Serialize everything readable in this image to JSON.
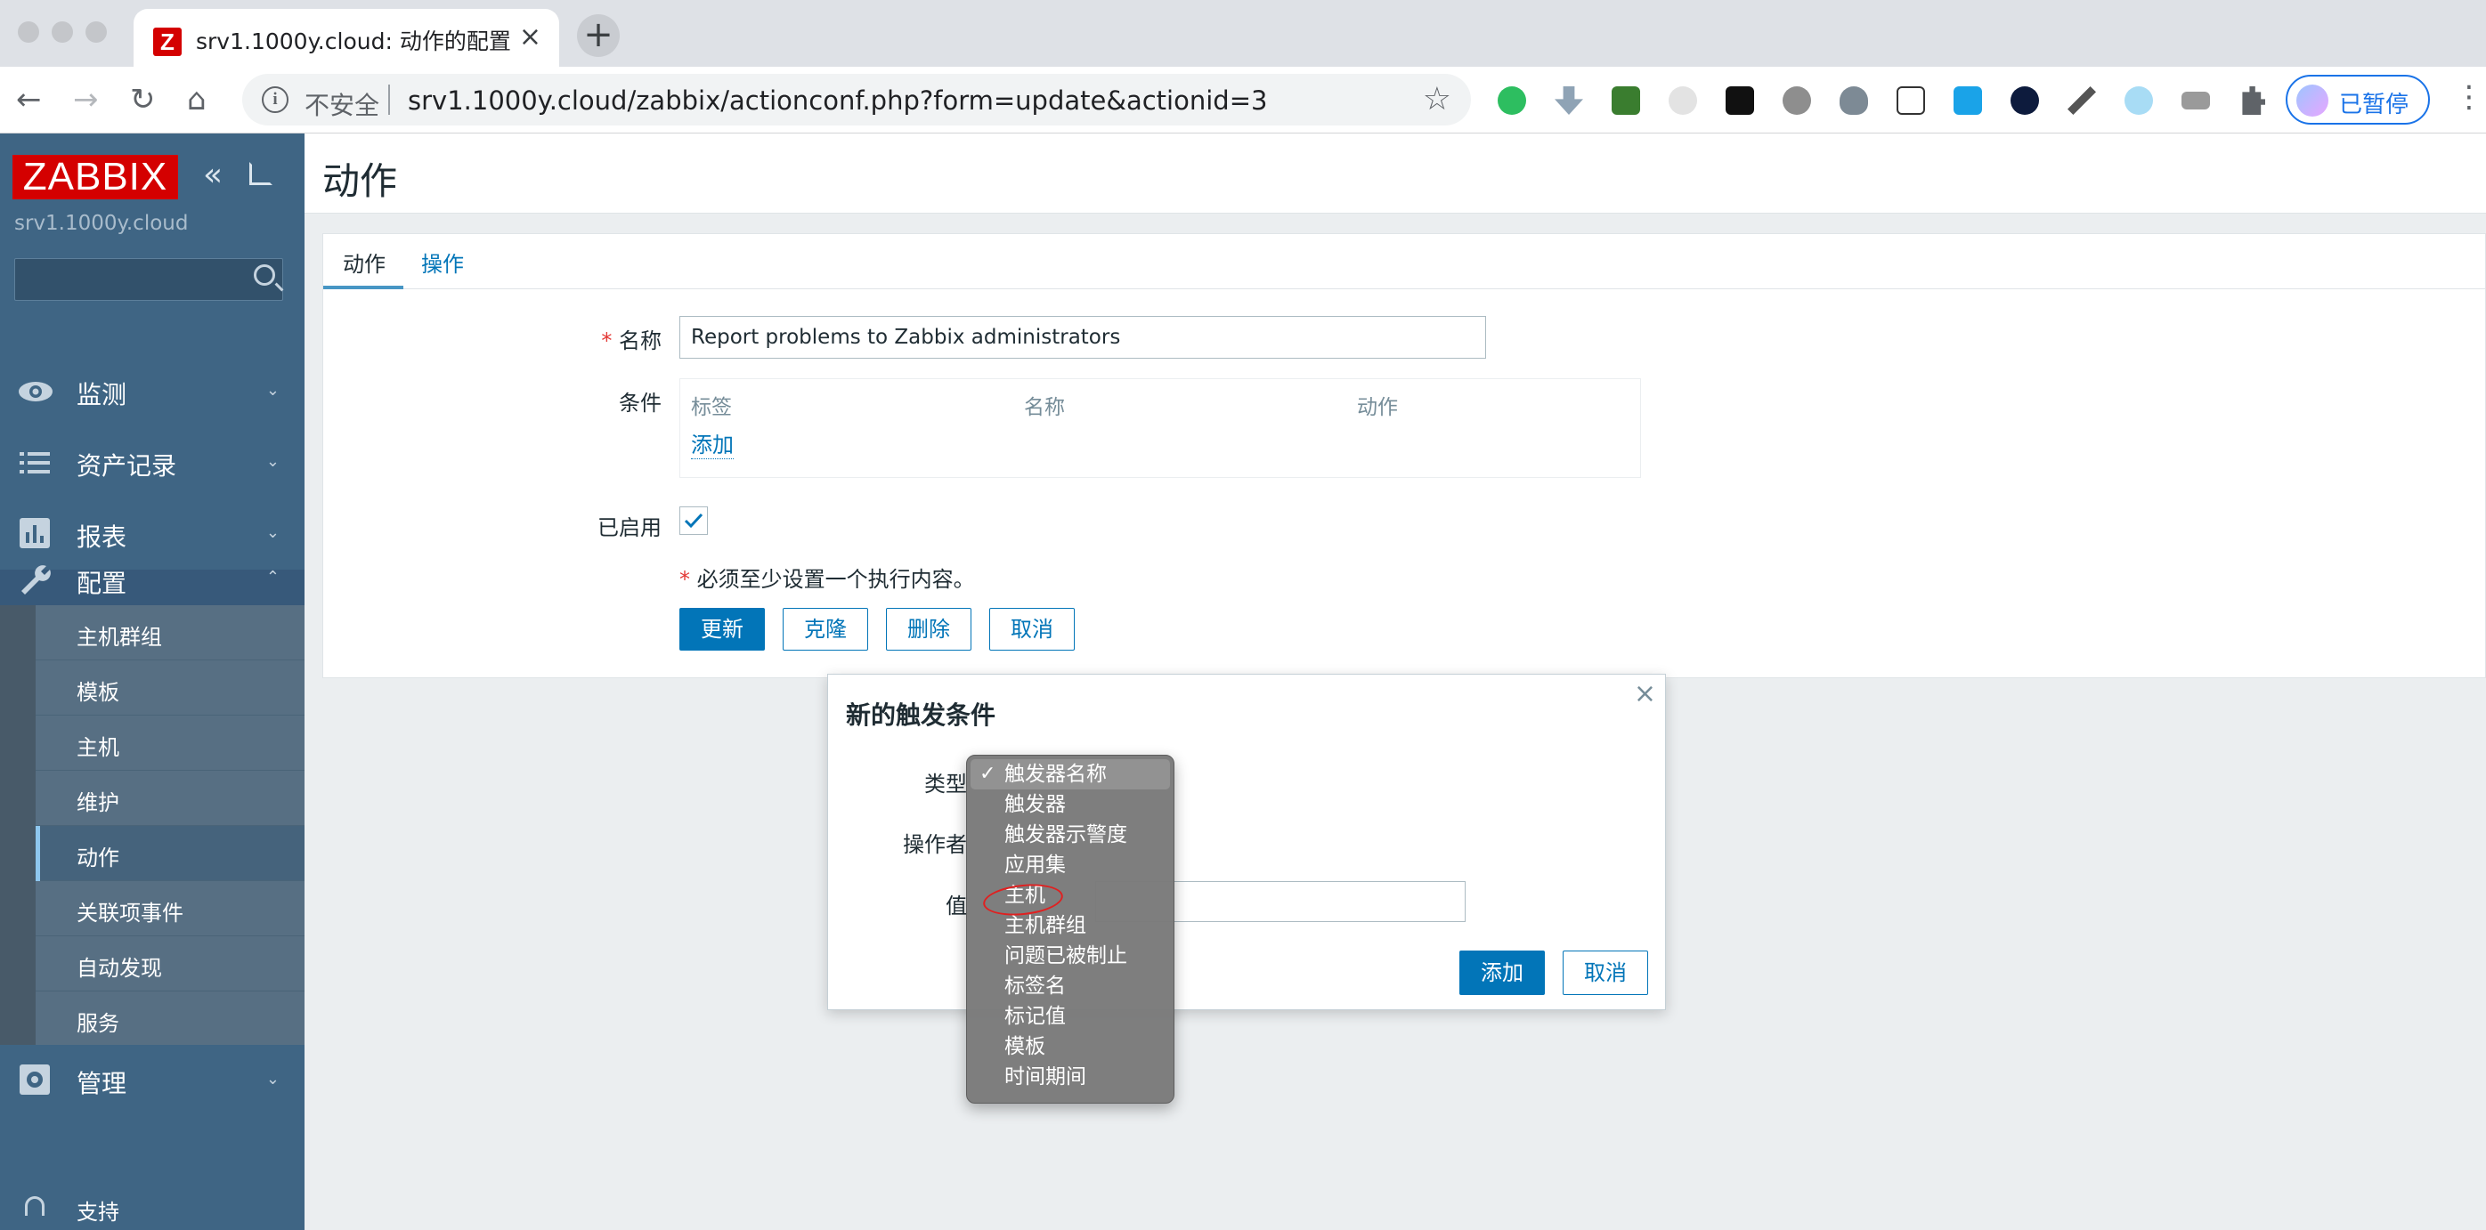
{
  "browser": {
    "tab_title": "srv1.1000y.cloud: 动作的配置",
    "tab_favicon_letter": "Z",
    "new_tab_symbol": "+",
    "insecure_label": "不安全",
    "url": "srv1.1000y.cloud/zabbix/actionconf.php?form=update&actionid=3",
    "profile_label": "已暂停",
    "extensions": [
      "evernote-icon",
      "download-icon",
      "translate-icon",
      "cloud-icon",
      "tampermonkey-icon",
      "record-icon",
      "shield-icon",
      "gitzip-icon",
      "screenshot-icon",
      "play-icon",
      "swords-icon",
      "cloud-sync-icon",
      "folder-icon",
      "puzzle-icon"
    ]
  },
  "sidebar": {
    "logo": "ZABBIX",
    "server_name": "srv1.1000y.cloud",
    "menu": [
      {
        "label": "监测",
        "icon": "eye-icon"
      },
      {
        "label": "资产记录",
        "icon": "list-icon"
      },
      {
        "label": "报表",
        "icon": "bar-chart-icon"
      },
      {
        "label": "配置",
        "icon": "wrench-icon"
      }
    ],
    "submenu": [
      "主机群组",
      "模板",
      "主机",
      "维护",
      "动作",
      "关联项事件",
      "自动发现",
      "服务"
    ],
    "admin": {
      "label": "管理",
      "icon": "gear-icon"
    },
    "support": "支持"
  },
  "page": {
    "title": "动作",
    "tabs": [
      "动作",
      "操作"
    ],
    "form": {
      "name_label": "名称",
      "name_value": "Report problems to Zabbix administrators",
      "conditions_label": "条件",
      "cond_headers": [
        "标签",
        "名称",
        "动作"
      ],
      "cond_add": "添加",
      "enabled_label": "已启用",
      "notice": "必须至少设置一个执行内容。",
      "required_mark": "*",
      "buttons": {
        "update": "更新",
        "clone": "克隆",
        "delete": "删除",
        "cancel": "取消"
      }
    }
  },
  "modal": {
    "title": "新的触发条件",
    "close": "×",
    "type_label": "类型",
    "operator_label": "操作者",
    "value_label": "值",
    "add": "添加",
    "cancel": "取消"
  },
  "dropdown": {
    "check": "✓",
    "options": [
      "触发器名称",
      "触发器",
      "触发器示警度",
      "应用集",
      "主机",
      "主机群组",
      "问题已被制止",
      "标签名",
      "标记值",
      "模板",
      "时间期间"
    ],
    "selected": "触发器名称"
  },
  "colors": {
    "sidebar": "#3f6584",
    "accent": "#0275b8",
    "logo_red": "#d40000"
  }
}
